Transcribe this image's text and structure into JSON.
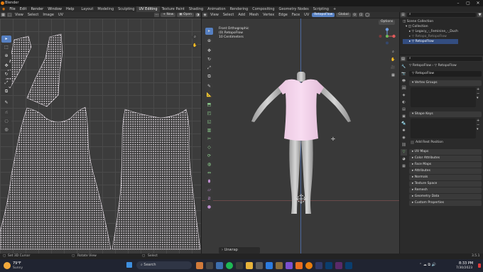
{
  "window": {
    "title": "Blender"
  },
  "menus": [
    "File",
    "Edit",
    "Render",
    "Window",
    "Help"
  ],
  "workspaces": [
    "Layout",
    "Modeling",
    "Sculpting",
    "UV Editing",
    "Texture Paint",
    "Shading",
    "Animation",
    "Rendering",
    "Compositing",
    "Geometry Nodes",
    "Scripting"
  ],
  "active_workspace": "UV Editing",
  "scene": {
    "label": "Scene",
    "view_layer": "ViewLayer"
  },
  "uv_editor": {
    "menus": [
      "View",
      "Select",
      "Image",
      "UV"
    ],
    "new_label": "New",
    "open_label": "Open"
  },
  "viewport": {
    "menus": [
      "View",
      "Select",
      "Add",
      "Mesh",
      "Vertex",
      "Edge",
      "Face",
      "UV"
    ],
    "object_name": "RetopoFlow",
    "transform": "Global",
    "info": [
      "Front Orthographic",
      "(0) RetopoFlow",
      "10 Centimeters"
    ],
    "options_label": "Options",
    "operator_panel": "Unwrap"
  },
  "outliner": {
    "items": [
      "Scene Collection",
      "Collection",
      "Legacy_-_Feminine_-_Duch",
      "Retopo_RetopoFlow",
      "RetopoFlow"
    ]
  },
  "properties": {
    "breadcrumb": [
      "RetopoFlow",
      "RetopoFlow"
    ],
    "mesh_name": "RetopoFlow",
    "sections": {
      "vertex_groups": "Vertex Groups",
      "shape_keys": "Shape Keys",
      "add_rest_position": "Add Rest Position",
      "panels": [
        "UV Maps",
        "Color Attributes",
        "Face Maps",
        "Attributes",
        "Normals",
        "Texture Space",
        "Remesh",
        "Geometry Data",
        "Custom Properties"
      ]
    }
  },
  "status": {
    "left": "Set 3D Cursor",
    "middle": "Rotate View",
    "right": "Select",
    "version": "3.5.1"
  },
  "taskbar": {
    "weather_temp": "79°F",
    "weather_desc": "Sunny",
    "search_placeholder": "Search",
    "time": "8:33 PM",
    "date": "7/30/2023"
  },
  "colors": {
    "accent": "#5680c2",
    "mesh": "#f2d2ea",
    "uv_dots": "#f0e8f0"
  }
}
